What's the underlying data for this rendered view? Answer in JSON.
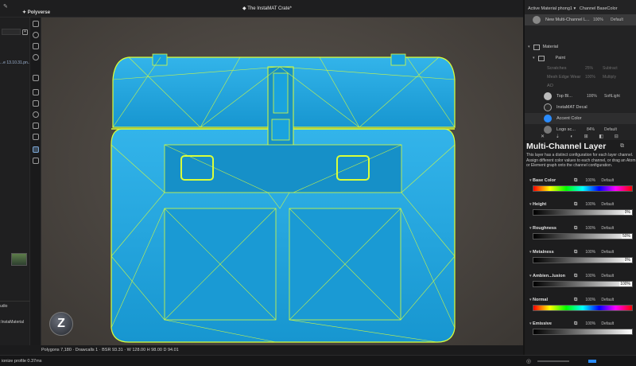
{
  "app": {
    "title": "The InstaMAT Crate*",
    "brand": "Polyverse"
  },
  "left_panel": {
    "file_label": "...e 13.10.31.pn...",
    "bottom_label_1": "udio",
    "bottom_label_2": ":InstaMaterial"
  },
  "status": {
    "stats": "Polygons 7,180 · Drawcalls 1 · BSR 93.31 · W 128.00 H 98.00 D 94.01",
    "profile": "ionize profile 0.37ms"
  },
  "header": {
    "active_material_label": "Active Material",
    "active_material_value": "phong1",
    "channel_label": "Channel",
    "channel_value": "BaseColor",
    "material_row": {
      "name": "New Multi-Channel L...",
      "opacity": "100%",
      "blend": "Default"
    }
  },
  "layers": [
    {
      "name": "Material",
      "opacity": "",
      "blend": ""
    },
    {
      "name": "Paint",
      "opacity": "",
      "blend": ""
    },
    {
      "name": "Scratches",
      "opacity": "25%",
      "blend": "Subtract"
    },
    {
      "name": "Mesh Edge Wear",
      "opacity": "100%",
      "blend": "Multiply"
    },
    {
      "name": "AO",
      "opacity": "",
      "blend": ""
    },
    {
      "name": "Top Bl...",
      "opacity": "100%",
      "blend": "SoftLight"
    },
    {
      "name": "InstaMAT Decal",
      "opacity": "100%",
      "blend": "Default"
    },
    {
      "name": "Accent Color",
      "opacity": "100%",
      "blend": "Default"
    },
    {
      "name": "Logo sc...",
      "opacity": "84%",
      "blend": "Default"
    }
  ],
  "props": {
    "title": "Multi-Channel Layer",
    "description": "This layer has a distinct configuration for each layer channel. Assign different color values to each channel, or drag an Atom or Element graph onto the channel configuration.",
    "channels": [
      {
        "name": "Base Color",
        "opacity": "100%",
        "blend": "Default",
        "value": "",
        "kind": "hue"
      },
      {
        "name": "Height",
        "opacity": "100%",
        "blend": "Default",
        "value": "0%",
        "kind": "gray"
      },
      {
        "name": "Roughness",
        "opacity": "100%",
        "blend": "Default",
        "value": "50%",
        "kind": "gray"
      },
      {
        "name": "Metalness",
        "opacity": "100%",
        "blend": "Default",
        "value": "0%",
        "kind": "gray"
      },
      {
        "name": "Ambien...lusion",
        "opacity": "100%",
        "blend": "Default",
        "value": "100%",
        "kind": "gray"
      },
      {
        "name": "Normal",
        "opacity": "100%",
        "blend": "Default",
        "value": "",
        "kind": "hue"
      },
      {
        "name": "Emissive",
        "opacity": "100%",
        "blend": "Default",
        "value": "",
        "kind": "gray"
      }
    ]
  },
  "colors": {
    "crate": "#1aa3de",
    "wire": "#d9ff3a",
    "accent": "#2a8cff"
  }
}
